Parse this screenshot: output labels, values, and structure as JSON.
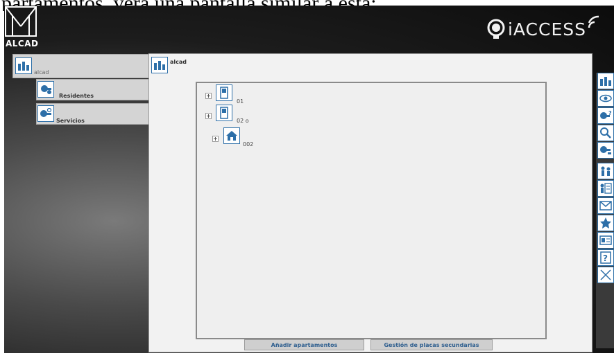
{
  "caption": "partamentos, verá una pantalla similar a ésta:",
  "brand": {
    "logo_text": "ALCAD",
    "product": "iACCESS"
  },
  "nav": {
    "root_label": "alcad",
    "sub_items": [
      {
        "label": "Residentes",
        "icon": "residents-icon"
      },
      {
        "label": "Servicios",
        "icon": "services-icon"
      }
    ]
  },
  "main": {
    "title": "alcad",
    "tree": [
      {
        "label": "01",
        "icon": "device-icon",
        "level": 0
      },
      {
        "label": "02 o",
        "icon": "device-icon",
        "level": 0
      },
      {
        "label": "002",
        "icon": "house-icon",
        "level": 1
      }
    ],
    "buttons": {
      "add_apartments": "Añadir apartamentos",
      "secondary_plates": "Gestión de placas secundarias"
    }
  },
  "toolbar": [
    "building-icon",
    "eye-icon",
    "key-question-icon",
    "search-icon",
    "key-extra-icon",
    "people-icon",
    "person-list-icon",
    "mail-icon",
    "star-icon",
    "card-icon",
    "help-icon",
    "close-icon"
  ],
  "colors": {
    "accent": "#2d6fa8",
    "panel": "#d4d4d4",
    "main_bg": "#f2f2f2"
  }
}
